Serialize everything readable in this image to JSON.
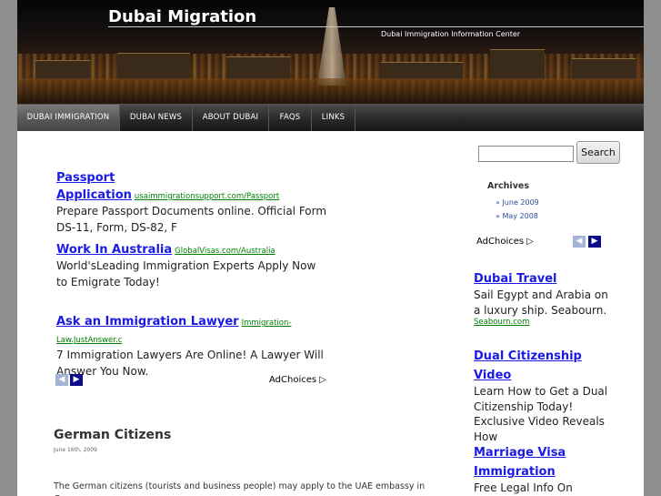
{
  "header": {
    "site_title": "Dubai Migration",
    "site_description": "Dubai Immigration Information Center"
  },
  "nav": {
    "items": [
      {
        "label": "DUBAI IMMIGRATION",
        "active": true
      },
      {
        "label": "DUBAI NEWS"
      },
      {
        "label": "ABOUT DUBAI"
      },
      {
        "label": "FAQS"
      },
      {
        "label": "LINKS"
      }
    ]
  },
  "main_ads": [
    {
      "title": "Passport Application",
      "url": "usaimmigrationsupport.com/Passport",
      "text": "Prepare Passport Documents online. Official Form DS-11, Form, DS-82, F"
    },
    {
      "title": "Work In Australia",
      "url": "GlobalVisas.com/Australia",
      "text": "World'sLeading Immigration Experts Apply Now to Emigrate Today!"
    },
    {
      "title": "Ask an Immigration Lawyer",
      "url": "Immigration-Law.JustAnswer.c",
      "text": "7 Immigration Lawyers Are Online! A Lawyer Will Answer You Now."
    }
  ],
  "adchoices_label": "AdChoices",
  "post": {
    "title": "German Citizens",
    "date": "June 16th, 2009",
    "body": "The German citizens (tourists and business people) may apply to the UAE embassy in Germany"
  },
  "sidebar": {
    "search_button": "Search",
    "archives_heading": "Archives",
    "archives": [
      "June 2009",
      "May 2008"
    ],
    "ads": [
      {
        "title": "Dubai Travel",
        "text": "Sail Egypt and Arabia on a luxury ship. Seabourn.",
        "url": "Seabourn.com"
      },
      {
        "title": "Dual Citizenship Video",
        "text": "Learn How to Get a Dual Citizenship Today! Exclusive Video Reveals How",
        "url": ""
      },
      {
        "title": "Marriage Visa Immigration",
        "text": "Free Legal Info On Marriage Based",
        "url": ""
      }
    ]
  },
  "colors": {
    "ad_link": "#1a1ae6",
    "ad_url": "#008000",
    "nav_bg": "#2b2b2b"
  }
}
